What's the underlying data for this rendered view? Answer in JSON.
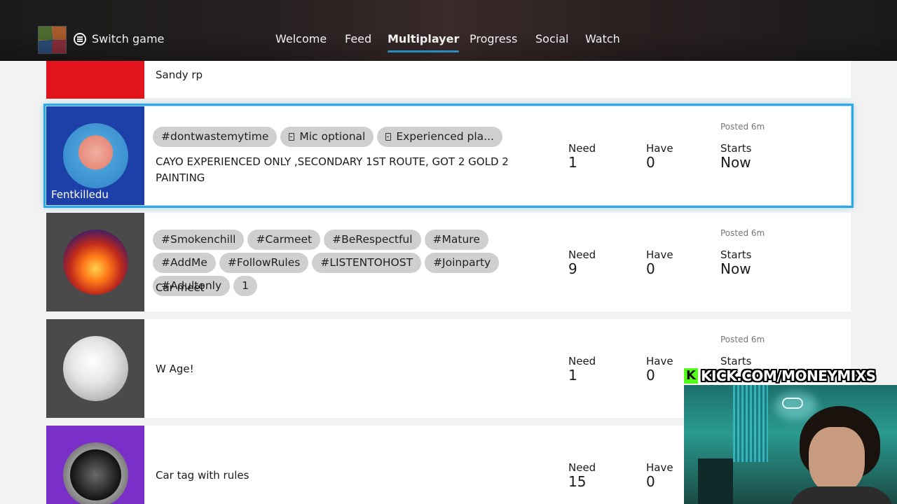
{
  "header": {
    "switch_game_label": "Switch game",
    "tabs": [
      {
        "label": "Welcome",
        "active": false
      },
      {
        "label": "Feed",
        "active": false
      },
      {
        "label": "Multiplayer",
        "active": true
      },
      {
        "label": "Progress",
        "active": false
      },
      {
        "label": "Social",
        "active": false
      },
      {
        "label": "Watch",
        "active": false
      }
    ],
    "accent_color": "#2fa8e8"
  },
  "posts": [
    {
      "description": "Sandy rp",
      "avatar_color": "#e3141b"
    },
    {
      "username": "Fentkilledu",
      "avatar_color": "#1c3fa8",
      "tags": [
        "#dontwastemytime",
        "Mic optional",
        "Experienced pla..."
      ],
      "description_line1": "CAYO EXPERIENCED ONLY ,SECONDARY 1ST ROUTE, GOT 2 GOLD 2",
      "description_line2": "PAINTING",
      "posted": "Posted 6m",
      "need_label": "Need",
      "need": "1",
      "have_label": "Have",
      "have": "0",
      "starts_label": "Starts",
      "starts": "Now",
      "selected": true
    },
    {
      "avatar_color": "#4a4a4a",
      "tags": [
        "#Smokenchill",
        "#Carmeet",
        "#BeRespectful",
        "#Mature",
        "#AddMe",
        "#FollowRules",
        "#LISTENTOHOST",
        "#Joinparty",
        "#Adultonly",
        "1"
      ],
      "description": "Car meet",
      "posted": "Posted 6m",
      "need_label": "Need",
      "need": "9",
      "have_label": "Have",
      "have": "0",
      "starts_label": "Starts",
      "starts": "Now"
    },
    {
      "avatar_color": "#4a4a4a",
      "description": "W Age!",
      "posted": "Posted 6m",
      "need_label": "Need",
      "need": "1",
      "have_label": "Have",
      "have": "0",
      "starts_label": "Starts"
    },
    {
      "avatar_color": "#7b2fc9",
      "description": "Car tag with rules",
      "need_label": "Need",
      "need": "15",
      "have_label": "Have",
      "have": "0"
    }
  ],
  "overlay": {
    "kick_text": "KICK.COM/MONEYMIXS",
    "kick_color": "#53fc18"
  }
}
